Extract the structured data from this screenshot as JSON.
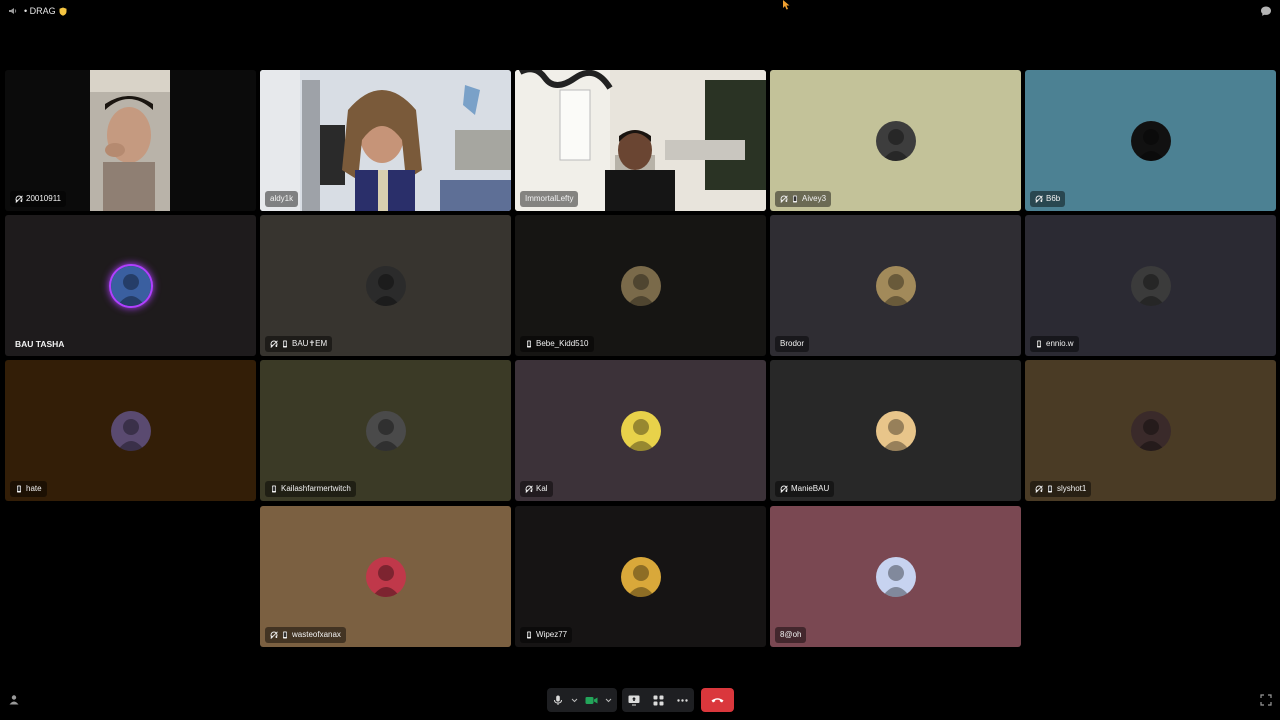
{
  "window": {
    "title": "• DRAG",
    "title_badge": "shield-emoji"
  },
  "colors": {
    "background": "#000000",
    "hangup": "#da373c",
    "video_on": "#23a55a",
    "ring": "#b040ff"
  },
  "tiles": [
    {
      "name": "20010911",
      "icons": [
        "deafened"
      ],
      "video": true,
      "bg": "#0d0d0d"
    },
    {
      "name": "aldy1k",
      "icons": [],
      "video": true,
      "bg": "#8a8f96"
    },
    {
      "name": "ImmortalLefty",
      "icons": [],
      "video": true,
      "bg": "#cfcac0"
    },
    {
      "name": "Aivey3",
      "icons": [
        "deafened",
        "mobile"
      ],
      "video": false,
      "bg": "#c3c299"
    },
    {
      "name": "B6b",
      "icons": [
        "deafened"
      ],
      "video": false,
      "bg": "#4c8193"
    },
    {
      "name": "BAU TASHA",
      "icons": [],
      "video": false,
      "bg": "#1e1b1c",
      "speaking": true
    },
    {
      "name": "BAU✝EM",
      "icons": [
        "deafened",
        "mobile"
      ],
      "video": false,
      "bg": "#37342f"
    },
    {
      "name": "Bebe_Kidd510",
      "icons": [
        "mobile"
      ],
      "video": false,
      "bg": "#161513"
    },
    {
      "name": "Brodor",
      "icons": [],
      "video": false,
      "bg": "#2f2d33"
    },
    {
      "name": "ennio.w",
      "icons": [
        "mobile"
      ],
      "video": false,
      "bg": "#2b2a33"
    },
    {
      "name": "hate",
      "icons": [
        "mobile"
      ],
      "video": false,
      "bg": "#331e07"
    },
    {
      "name": "Kailashfarmertwitch",
      "icons": [
        "mobile"
      ],
      "video": false,
      "bg": "#3b3a26"
    },
    {
      "name": "Kal",
      "icons": [
        "deafened"
      ],
      "video": false,
      "bg": "#3c3239"
    },
    {
      "name": "ManieBAU",
      "icons": [
        "deafened"
      ],
      "video": false,
      "bg": "#282828"
    },
    {
      "name": "slyshot1",
      "icons": [
        "deafened",
        "mobile"
      ],
      "video": false,
      "bg": "#4a3b25"
    },
    {
      "name": "wasteofxanax",
      "icons": [
        "deafened",
        "mobile"
      ],
      "video": false,
      "bg": "#7b6041"
    },
    {
      "name": "Wipez77",
      "icons": [
        "mobile"
      ],
      "video": false,
      "bg": "#161414"
    },
    {
      "name": "8@oh",
      "icons": [],
      "video": false,
      "bg": "#7a4852"
    }
  ],
  "controls": {
    "mic_icon": "microphone-icon",
    "camera_icon": "video-camera-icon",
    "screenshare_icon": "screen-share-icon",
    "activities_icon": "activities-icon",
    "more_icon": "more-dots-icon",
    "hangup_icon": "phone-hangup-icon"
  }
}
